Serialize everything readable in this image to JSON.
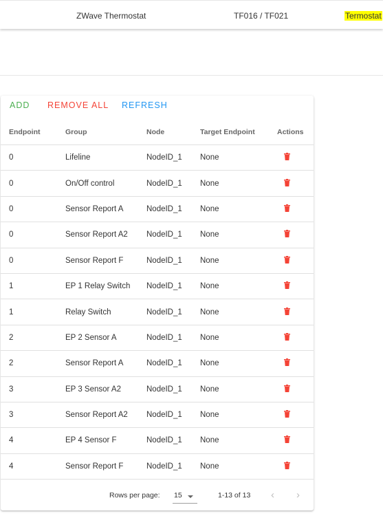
{
  "device": {
    "name": "ZWave Thermostat",
    "product": "TF016 / TF021",
    "type": "Termostat"
  },
  "toolbar": {
    "add_label": "ADD",
    "remove_all_label": "REMOVE ALL",
    "refresh_label": "REFRESH"
  },
  "table": {
    "headers": [
      "Endpoint",
      "Group",
      "Node",
      "Target Endpoint",
      "Actions"
    ],
    "rows": [
      {
        "endpoint": "0",
        "group": "Lifeline",
        "node": "NodeID_1",
        "target": "None"
      },
      {
        "endpoint": "0",
        "group": "On/Off control",
        "node": "NodeID_1",
        "target": "None"
      },
      {
        "endpoint": "0",
        "group": "Sensor Report A",
        "node": "NodeID_1",
        "target": "None"
      },
      {
        "endpoint": "0",
        "group": "Sensor Report A2",
        "node": "NodeID_1",
        "target": "None"
      },
      {
        "endpoint": "0",
        "group": "Sensor Report F",
        "node": "NodeID_1",
        "target": "None"
      },
      {
        "endpoint": "1",
        "group": "EP 1 Relay Switch",
        "node": "NodeID_1",
        "target": "None"
      },
      {
        "endpoint": "1",
        "group": "Relay Switch",
        "node": "NodeID_1",
        "target": "None"
      },
      {
        "endpoint": "2",
        "group": "EP 2 Sensor A",
        "node": "NodeID_1",
        "target": "None"
      },
      {
        "endpoint": "2",
        "group": "Sensor Report A",
        "node": "NodeID_1",
        "target": "None"
      },
      {
        "endpoint": "3",
        "group": "EP 3 Sensor A2",
        "node": "NodeID_1",
        "target": "None"
      },
      {
        "endpoint": "3",
        "group": "Sensor Report A2",
        "node": "NodeID_1",
        "target": "None"
      },
      {
        "endpoint": "4",
        "group": "EP 4 Sensor F",
        "node": "NodeID_1",
        "target": "None"
      },
      {
        "endpoint": "4",
        "group": "Sensor Report F",
        "node": "NodeID_1",
        "target": "None"
      }
    ]
  },
  "pagination": {
    "rows_per_page_label": "Rows per page:",
    "rows_per_page_value": "15",
    "range_text": "1-13 of 13",
    "prev_icon": "chevron-left-icon",
    "next_icon": "chevron-right-icon"
  },
  "icons": {
    "row_action": "trash-icon"
  },
  "colors": {
    "add": "#4caf50",
    "remove": "#f44336",
    "refresh": "#2196f3",
    "trash": "#f44336",
    "highlight": "#ffff00"
  }
}
